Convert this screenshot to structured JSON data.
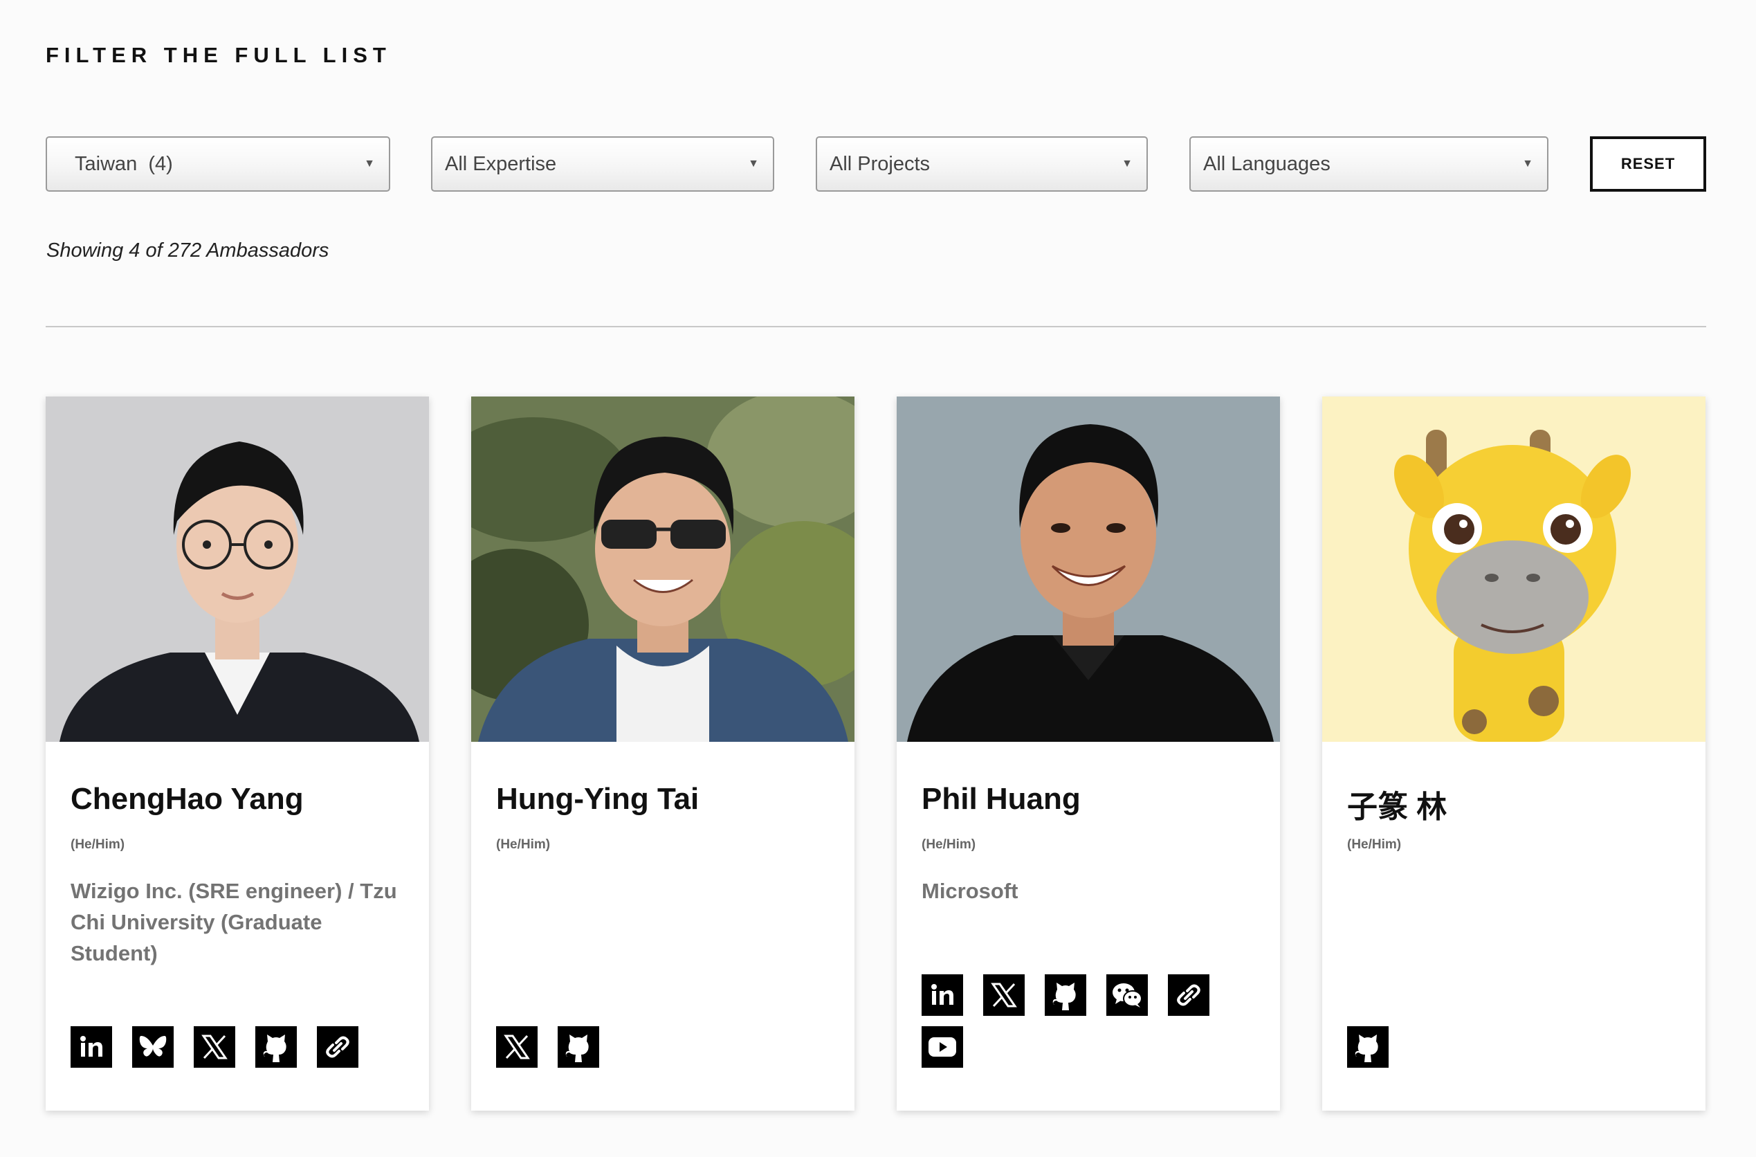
{
  "filter": {
    "heading": "FILTER THE FULL LIST",
    "country_select": "Taiwan  (4)",
    "expertise_select": "All Expertise",
    "projects_select": "All Projects",
    "languages_select": "All Languages",
    "reset_label": "RESET"
  },
  "results": {
    "showing_text": "Showing 4 of 272 Ambassadors"
  },
  "ambassadors": [
    {
      "name": "ChengHao Yang",
      "pronouns": "(He/Him)",
      "organization": "Wizigo Inc. (SRE engineer) / Tzu Chi University (Graduate Student)",
      "socials": [
        "linkedin-icon",
        "bluesky-icon",
        "x-icon",
        "github-icon",
        "link-icon"
      ]
    },
    {
      "name": "Hung-Ying Tai",
      "pronouns": "(He/Him)",
      "organization": "",
      "socials": [
        "x-icon",
        "github-icon"
      ]
    },
    {
      "name": "Phil Huang",
      "pronouns": "(He/Him)",
      "organization": "Microsoft",
      "socials": [
        "linkedin-icon",
        "x-icon",
        "github-icon",
        "wechat-icon",
        "link-icon",
        "youtube-icon"
      ]
    },
    {
      "name": "子篆 林",
      "pronouns": "(He/Him)",
      "organization": "",
      "socials": [
        "github-icon"
      ]
    }
  ]
}
